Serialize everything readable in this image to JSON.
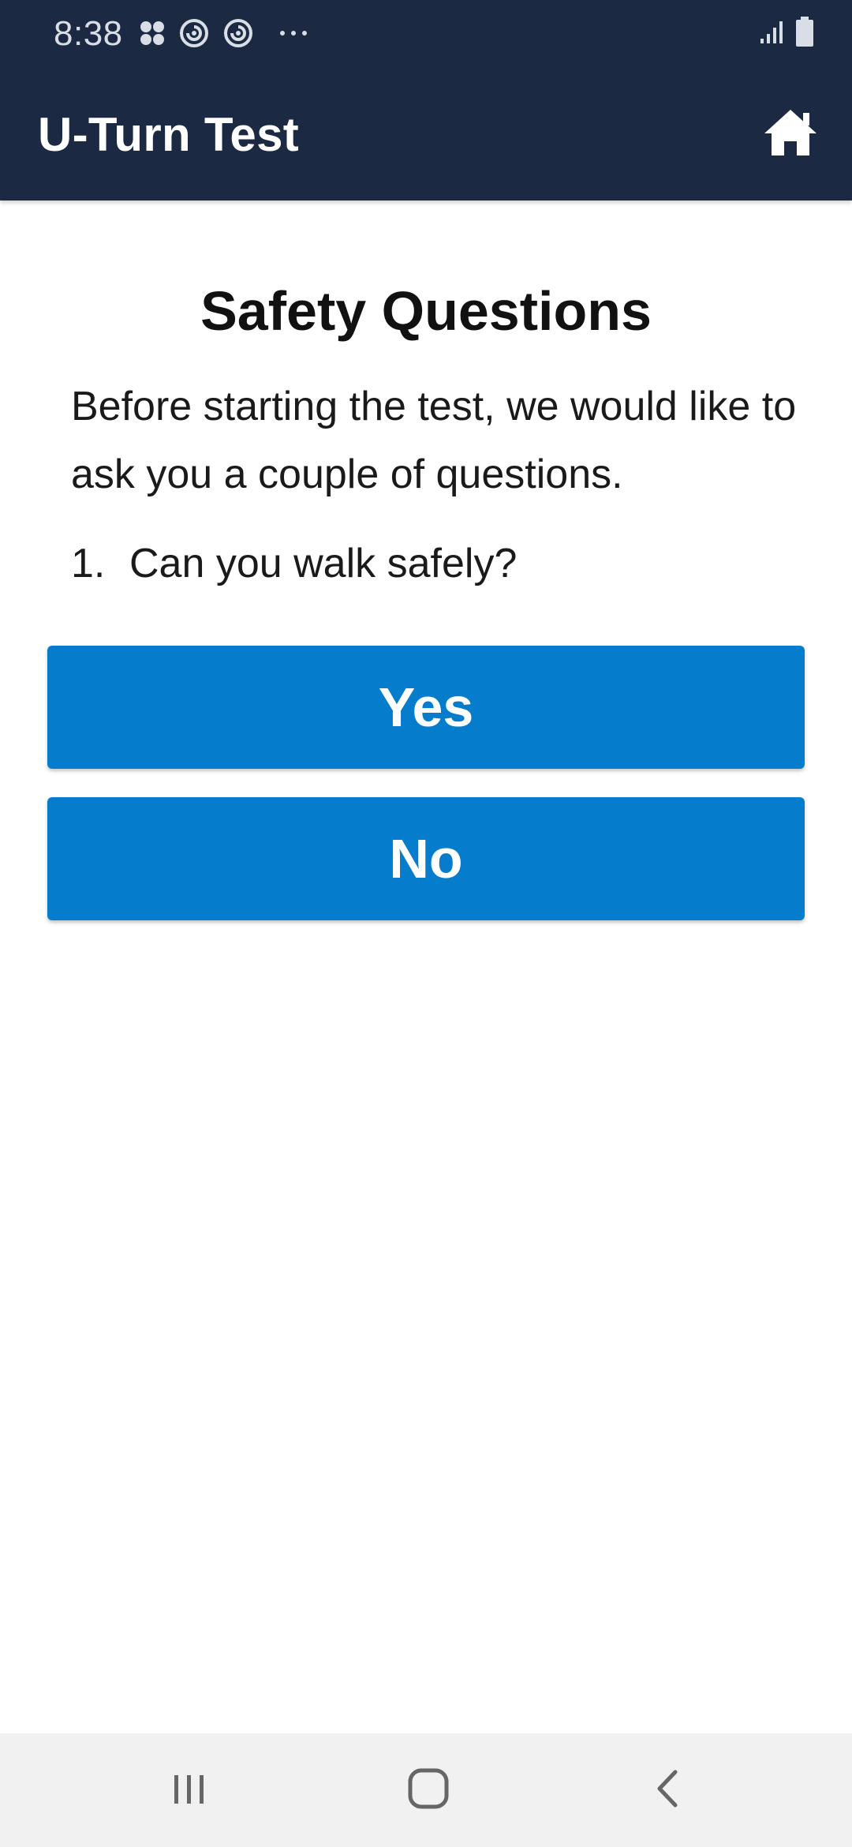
{
  "status_bar": {
    "time": "8:38",
    "icons_left": [
      "apps-dots-icon",
      "sync-icon",
      "sync-icon",
      "more-dots-icon"
    ],
    "icons_right": [
      "signal-icon",
      "battery-icon"
    ]
  },
  "app_bar": {
    "title": "U-Turn Test",
    "home_icon": "home-icon",
    "color": "#1b2a42"
  },
  "main": {
    "title": "Safety Questions",
    "intro": "Before starting the test, we would like to ask you a couple of questions.",
    "question_number": "1.",
    "question_text": "Can you walk safely?",
    "answers": {
      "yes_label": "Yes",
      "no_label": "No"
    },
    "button_color": "#067dcc"
  },
  "nav_bar": {
    "items": [
      "recents-icon",
      "home-outline-icon",
      "back-icon"
    ]
  }
}
